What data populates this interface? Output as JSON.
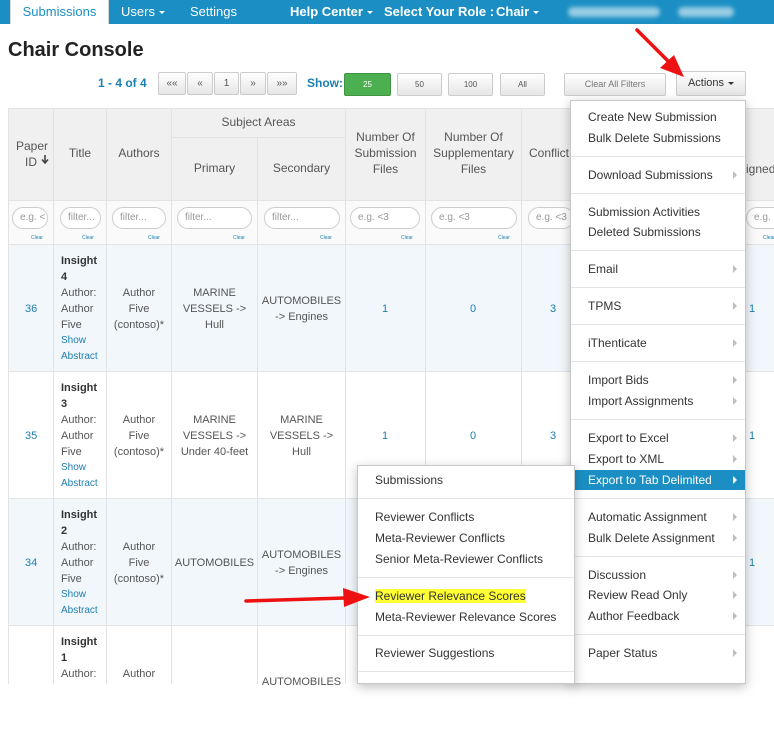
{
  "nav": {
    "submissions": "Submissions",
    "users": "Users",
    "settings": "Settings",
    "help_center": "Help Center",
    "select_role_label": "Select Your Role :",
    "role": "Chair"
  },
  "page": {
    "title": "Chair Console"
  },
  "pager": {
    "summary": "1 - 4 of 4",
    "first": "««",
    "prev": "«",
    "page": "1",
    "next": "»",
    "last": "»»",
    "show_label": "Show:",
    "sizes": [
      "25",
      "50",
      "100",
      "All"
    ],
    "active_size": "25",
    "clear_filters": "Clear All Filters",
    "actions": "Actions"
  },
  "table": {
    "headers": {
      "paper_id": "Paper ID",
      "sort_icon": "sort-down-icon",
      "title": "Title",
      "authors": "Authors",
      "subject_areas": "Subject Areas",
      "primary": "Primary",
      "secondary": "Secondary",
      "num_submission_files": "Number Of Submission Files",
      "num_supplementary_files": "Number Of Supplementary Files",
      "conflicts": "Conflict",
      "assigned_partial": "igned"
    },
    "filters": {
      "paper_id": "e.g. <",
      "title": "filter...",
      "authors": "filter...",
      "primary": "filter...",
      "secondary": "filter...",
      "num_submission_files": "e.g. <3",
      "num_supplementary_files": "e.g. <3",
      "conflicts": "e.g. <3",
      "assigned": "e.g. <3",
      "clear": "Clear"
    },
    "rows": [
      {
        "id": "36",
        "title": "Insight 4",
        "author_line1": "Author:",
        "author_line2": "Author",
        "author_line3": "Five",
        "show": "Show",
        "abstract": "Abstract",
        "authors_1": "Author",
        "authors_2": "Five",
        "authors_3": "(contoso)*",
        "primary_1": "MARINE",
        "primary_2": "VESSELS ->",
        "primary_3": "Hull",
        "secondary_1": "AUTOMOBILES",
        "secondary_2": "-> Engines",
        "secondary_3": "",
        "sub_files": "1",
        "supp_files": "0",
        "conflicts": "3",
        "assigned": "1"
      },
      {
        "id": "35",
        "title": "Insight 3",
        "author_line1": "Author:",
        "author_line2": "Author",
        "author_line3": "Five",
        "show": "Show",
        "abstract": "Abstract",
        "authors_1": "Author",
        "authors_2": "Five",
        "authors_3": "(contoso)*",
        "primary_1": "MARINE",
        "primary_2": "VESSELS ->",
        "primary_3": "Under 40-feet",
        "secondary_1": "MARINE",
        "secondary_2": "VESSELS ->",
        "secondary_3": "Hull",
        "sub_files": "1",
        "supp_files": "0",
        "conflicts": "3",
        "assigned": "1"
      },
      {
        "id": "34",
        "title": "Insight 2",
        "author_line1": "Author:",
        "author_line2": "Author",
        "author_line3": "Five",
        "show": "Show",
        "abstract": "Abstract",
        "authors_1": "Author",
        "authors_2": "Five",
        "authors_3": "(contoso)*",
        "primary_1": "AUTOMOBILES",
        "primary_2": "",
        "primary_3": "",
        "secondary_1": "AUTOMOBILES",
        "secondary_2": "-> Engines",
        "secondary_3": "",
        "sub_files": "",
        "supp_files": "",
        "conflicts": "",
        "assigned": "1"
      },
      {
        "id": "",
        "title": "Insight 1",
        "author_line1": "Author:",
        "authors_1": "Author",
        "secondary_1": "AUTOMOBILES"
      }
    ]
  },
  "actions_menu": {
    "items": [
      "Create New Submission",
      "Bulk Delete Submissions",
      "Download Submissions",
      "Submission Activities",
      "Deleted Submissions",
      "Email",
      "TPMS",
      "iThenticate",
      "Import Bids",
      "Import Assignments",
      "Export to Excel",
      "Export to XML",
      "Export to Tab Delimited",
      "Automatic Assignment",
      "Bulk Delete Assignment",
      "Discussion",
      "Review Read Only",
      "Author Feedback",
      "Paper Status"
    ],
    "highlighted": "Export to Tab Delimited"
  },
  "export_submenu": {
    "items": [
      "Submissions",
      "Reviewer Conflicts",
      "Meta-Reviewer Conflicts",
      "Senior Meta-Reviewer Conflicts",
      "Reviewer Relevance Scores",
      "Meta-Reviewer Relevance Scores",
      "Reviewer Suggestions"
    ],
    "highlighted": "Reviewer Relevance Scores"
  },
  "colors": {
    "navbar": "#1b8fc4",
    "link": "#1b7fb3",
    "active_page_size": "#4caf50",
    "menu_highlight": "#1b8fc4",
    "text_highlight": "#ffff33",
    "annotation_arrow": "#ee1111"
  }
}
